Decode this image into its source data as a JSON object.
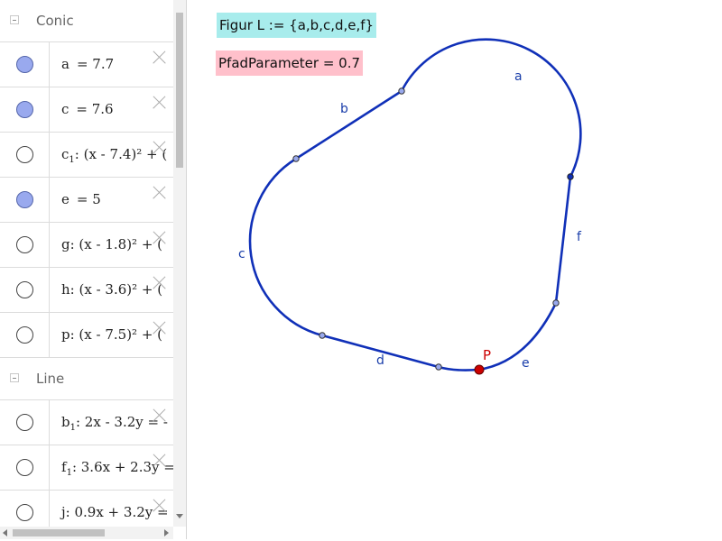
{
  "algebra": {
    "groups": [
      {
        "title": "Conic",
        "items": [
          {
            "name": "a",
            "expr": "= 7.7",
            "visible": true
          },
          {
            "name": "c",
            "expr": "= 7.6",
            "visible": true
          },
          {
            "name": "c",
            "sub": "1",
            "expr": ": (x - 7.4)² + (",
            "visible": false
          },
          {
            "name": "e",
            "expr": "= 5",
            "visible": true
          },
          {
            "name": "g",
            "expr": ": (x - 1.8)² + (",
            "visible": false
          },
          {
            "name": "h",
            "expr": ": (x - 3.6)² + (",
            "visible": false
          },
          {
            "name": "p",
            "expr": ": (x - 7.5)² + (",
            "visible": false
          }
        ]
      },
      {
        "title": "Line",
        "items": [
          {
            "name": "b",
            "sub": "1",
            "expr": ": 2x - 3.2y = -",
            "visible": false
          },
          {
            "name": "f",
            "sub": "1",
            "expr": ": 3.6x + 2.3y =",
            "visible": false
          },
          {
            "name": "j",
            "expr": ": 0.9x + 3.2y =",
            "visible": false
          }
        ]
      }
    ]
  },
  "graphics": {
    "figur_text": "Figur L := {a,b,c,d,e,f}",
    "param_text": "PfadParameter = 0.7",
    "point_label": "P",
    "segment_labels": {
      "a": "a",
      "b": "b",
      "c": "c",
      "d": "d",
      "e": "e",
      "f": "f"
    },
    "colors": {
      "curve": "#1030b8",
      "point_fill": "#cc0000",
      "label_box_figur": "#a8ecec",
      "label_box_param": "#ffc0cb"
    }
  }
}
